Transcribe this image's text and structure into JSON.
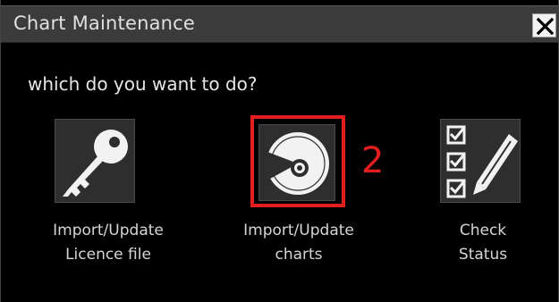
{
  "dialog": {
    "title": "Chart Maintenance",
    "close_icon": "close-icon",
    "prompt": "which do you want to do?"
  },
  "options": [
    {
      "icon": "key-icon",
      "label_line1": "Import/Update",
      "label_line2": "Licence file"
    },
    {
      "icon": "disc-icon",
      "label_line1": "Import/Update",
      "label_line2": "charts"
    },
    {
      "icon": "checklist-icon",
      "label_line1": "Check",
      "label_line2": "Status"
    }
  ],
  "annotation": {
    "step_number": "2",
    "color": "#e41e1e"
  }
}
